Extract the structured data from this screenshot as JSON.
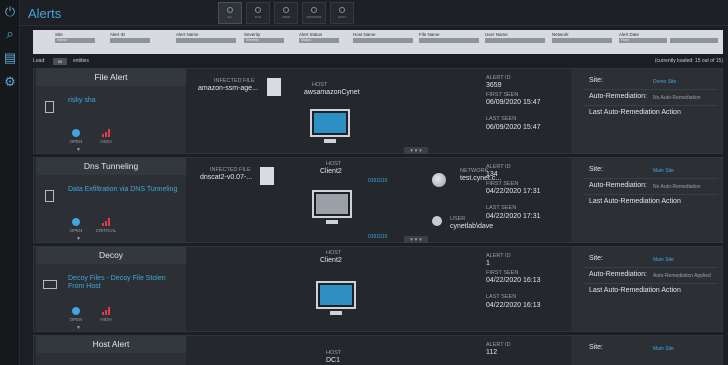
{
  "app": {
    "title": "Alerts"
  },
  "tabs": [
    {
      "label": "ALL"
    },
    {
      "label": "FILE"
    },
    {
      "label": "USER"
    },
    {
      "label": "NETWORK"
    },
    {
      "label": "HOST"
    }
  ],
  "filters": [
    {
      "label": "Site",
      "value": "Select"
    },
    {
      "label": "Alert ID",
      "value": ""
    },
    {
      "label": "Alert Name",
      "value": ""
    },
    {
      "label": "Severity",
      "value": "Severity"
    },
    {
      "label": "Alert Status",
      "value": "Status"
    },
    {
      "label": "Host Name",
      "value": ""
    },
    {
      "label": "File Name",
      "value": ""
    },
    {
      "label": "User Name",
      "value": ""
    },
    {
      "label": "Network",
      "value": ""
    },
    {
      "label": "Alert Date",
      "value": "From"
    }
  ],
  "load": {
    "label": "Load:",
    "value": "50",
    "suffix": "entities",
    "status": "(currently loaded: 15 out of 15)"
  },
  "labels": {
    "infected_file": "INFECTED FILE",
    "host": "HOST",
    "network": "NETWORK",
    "user": "USER",
    "alert_id": "ALERT ID",
    "first_seen": "FIRST SEEN",
    "last_seen": "LAST SEEN",
    "site": "Site:",
    "auto_rem": "Auto-Remediation:",
    "last_action": "Last Auto-Remediation Action",
    "expander": "▼▼▼"
  },
  "alerts": [
    {
      "category": "File Alert",
      "name": "risky sha",
      "status": "OPEN",
      "severity": "HIGH",
      "infected_file": "amazon-ssm-age...",
      "host": "awsamazonCynet",
      "alert_id": "3659",
      "first_seen": "06/09/2020 15:47",
      "last_seen": "06/09/2020 15:47",
      "site": "Demo Site",
      "auto_remediation": "No Auto-Remediation"
    },
    {
      "category": "Dns Tunneling",
      "name": "Data Exfiltration via DNS Tunneling",
      "status": "OPEN",
      "severity": "CRITICAL",
      "infected_file": "dnscat2-v0.07-...",
      "host": "Client2",
      "network": "test.cynet.c...",
      "user": "cynetlab\\dave",
      "bin_top": "0101010",
      "bin_bottom": "0101010",
      "alert_id": "134",
      "first_seen": "04/22/2020 17:31",
      "last_seen": "04/22/2020 17:31",
      "site": "Main Site",
      "auto_remediation": "No Auto-Remediation"
    },
    {
      "category": "Decoy",
      "name": "Decoy Files - Decoy File Stolen From Host",
      "status": "OPEN",
      "severity": "HIGH",
      "host": "Client2",
      "alert_id": "1",
      "first_seen": "04/22/2020 16:13",
      "last_seen": "04/22/2020 16:13",
      "site": "Main Site",
      "auto_remediation": "Auto-Remediation Applied"
    },
    {
      "category": "Host Alert",
      "host": "DC1",
      "alert_id": "112",
      "site": "Main Site"
    }
  ],
  "colors": {
    "accent": "#3fa6e0",
    "critical": "#e8394a",
    "bg": "#1b1e22"
  }
}
